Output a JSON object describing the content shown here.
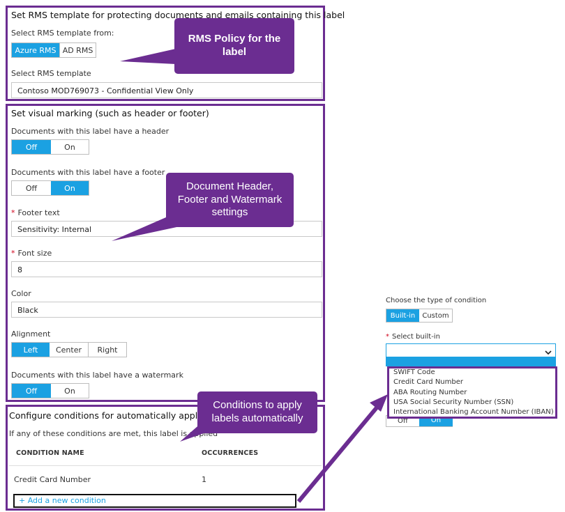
{
  "rms": {
    "title": "Set RMS template for protecting documents and emails containing this label",
    "select_from_label": "Select RMS template from:",
    "from_options": [
      "Azure RMS",
      "AD RMS"
    ],
    "template_label": "Select RMS template",
    "template_value": "Contoso MOD769073 - Confidential View Only"
  },
  "marking": {
    "title": "Set visual marking (such as header or footer)",
    "header_label": "Documents with this label have a header",
    "footer_label": "Documents with this label have a footer",
    "off": "Off",
    "on": "On",
    "footer_text_label": "Footer text",
    "footer_text_value": "Sensitivity: Internal",
    "font_size_label": "Font size",
    "font_size_value": "8",
    "color_label": "Color",
    "color_value": "Black",
    "alignment_label": "Alignment",
    "alignment_options": [
      "Left",
      "Center",
      "Right"
    ],
    "watermark_label": "Documents with this label have a watermark"
  },
  "conditions": {
    "title": "Configure conditions for automatically applying",
    "subtitle": "If any of these conditions are met, this label is applied",
    "col_name": "CONDITION NAME",
    "col_occurrences": "OCCURRENCES",
    "row_name": "Credit Card Number",
    "row_occurrences": "1",
    "add_link": "+ Add a new condition"
  },
  "callouts": {
    "rms": "RMS Policy for the label",
    "header_footer": "Document Header, Footer and Watermark settings",
    "conditions": "Conditions to apply labels automatically"
  },
  "condition_panel": {
    "type_label": "Choose the type of condition",
    "type_options": [
      "Built-in",
      "Custom"
    ],
    "select_label": "Select built-in",
    "dropdown_items": [
      "SWIFT Code",
      "Credit Card Number",
      "ABA Routing Number",
      "USA Social Security Number (SSN)",
      "International Banking Account Number (IBAN)"
    ],
    "off": "Off",
    "on": "On"
  },
  "colors": {
    "accent": "#1ba1e2",
    "callout_purple": "#6b2d91",
    "required": "#d0021b"
  }
}
